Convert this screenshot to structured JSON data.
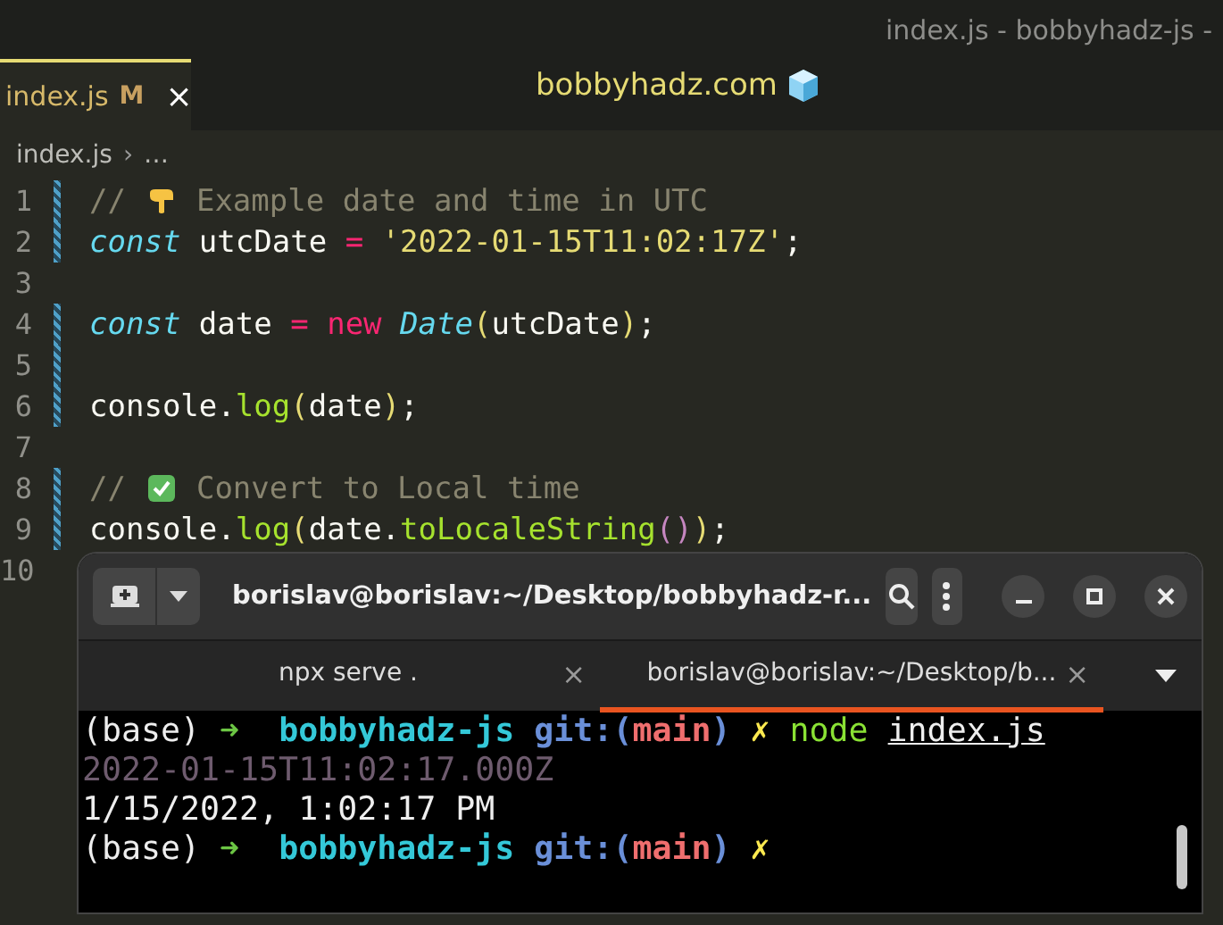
{
  "window": {
    "title": "index.js - bobbyhadz-js -"
  },
  "editor_tab": {
    "label": "index.js",
    "badge": "M",
    "close": "×",
    "selected": true
  },
  "brand": {
    "text": "bobbyhadz.com"
  },
  "breadcrumb": {
    "file": "index.js",
    "separator": "›",
    "rest": "…"
  },
  "code_lines": [
    {
      "number": "1",
      "changed": true,
      "tokens": [
        {
          "kind": "comment",
          "text": "// "
        },
        {
          "kind": "hand"
        },
        {
          "kind": "comment",
          "text": " Example date and time in UTC"
        }
      ]
    },
    {
      "number": "2",
      "changed": true,
      "tokens": [
        {
          "kind": "storage",
          "text": "const"
        },
        {
          "kind": "plain",
          "text": " utcDate "
        },
        {
          "kind": "operator",
          "text": "= "
        },
        {
          "kind": "string",
          "text": "'2022-01-15T11:02:17Z'"
        },
        {
          "kind": "plain",
          "text": ";"
        }
      ]
    },
    {
      "number": "3",
      "changed": false
    },
    {
      "number": "4",
      "changed": true,
      "tokens": [
        {
          "kind": "storage",
          "text": "const"
        },
        {
          "kind": "plain",
          "text": " date "
        },
        {
          "kind": "operator",
          "text": "= new "
        },
        {
          "kind": "class",
          "text": "Date"
        },
        {
          "kind": "bracket",
          "text": "("
        },
        {
          "kind": "plain",
          "text": "utcDate"
        },
        {
          "kind": "bracket",
          "text": ")"
        },
        {
          "kind": "plain",
          "text": ";"
        }
      ]
    },
    {
      "number": "5",
      "changed": true
    },
    {
      "number": "6",
      "changed": true,
      "tokens": [
        {
          "kind": "plain",
          "text": "console."
        },
        {
          "kind": "function",
          "text": "log"
        },
        {
          "kind": "bracket",
          "text": "("
        },
        {
          "kind": "plain",
          "text": "date"
        },
        {
          "kind": "bracket",
          "text": ")"
        },
        {
          "kind": "plain",
          "text": ";"
        }
      ]
    },
    {
      "number": "7",
      "changed": false
    },
    {
      "number": "8",
      "changed": true,
      "tokens": [
        {
          "kind": "comment",
          "text": "// "
        },
        {
          "kind": "check"
        },
        {
          "kind": "comment",
          "text": " Convert to Local time"
        }
      ]
    },
    {
      "number": "9",
      "changed": true,
      "tokens": [
        {
          "kind": "plain",
          "text": "console."
        },
        {
          "kind": "function",
          "text": "log"
        },
        {
          "kind": "bracket",
          "text": "("
        },
        {
          "kind": "plain",
          "text": "date."
        },
        {
          "kind": "function",
          "text": "toLocaleString"
        },
        {
          "kind": "bracket2",
          "text": "()"
        },
        {
          "kind": "bracket",
          "text": ")"
        },
        {
          "kind": "plain",
          "text": ";"
        }
      ]
    },
    {
      "number": "10",
      "changed": false
    }
  ],
  "terminal": {
    "title": "borislav@borislav:~/Desktop/bobbyhadz-r...",
    "tabs": [
      {
        "label": "npx serve .",
        "close": "×",
        "selected": false
      },
      {
        "label": "borislav@borislav:~/Desktop/b...",
        "close": "×",
        "selected": true
      }
    ],
    "lines": [
      [
        {
          "kind": "plain",
          "text": "(base) "
        },
        {
          "kind": "arrow",
          "text": "➜  "
        },
        {
          "kind": "dir",
          "text": "bobbyhadz-js "
        },
        {
          "kind": "git",
          "text": "git:("
        },
        {
          "kind": "branch",
          "text": "main"
        },
        {
          "kind": "git",
          "text": ") "
        },
        {
          "kind": "dirty",
          "text": "✗ "
        },
        {
          "kind": "command",
          "text": "node "
        },
        {
          "kind": "link",
          "text": "index.js"
        }
      ],
      [
        {
          "kind": "dim",
          "text": "2022-01-15T11:02:17.000Z"
        }
      ],
      [
        {
          "kind": "plain",
          "text": "1/15/2022, 1:02:17 PM"
        }
      ],
      [
        {
          "kind": "plain",
          "text": "(base) "
        },
        {
          "kind": "arrow",
          "text": "➜  "
        },
        {
          "kind": "dir",
          "text": "bobbyhadz-js "
        },
        {
          "kind": "git",
          "text": "git:("
        },
        {
          "kind": "branch",
          "text": "main"
        },
        {
          "kind": "git",
          "text": ") "
        },
        {
          "kind": "dirty",
          "text": "✗"
        }
      ]
    ]
  }
}
